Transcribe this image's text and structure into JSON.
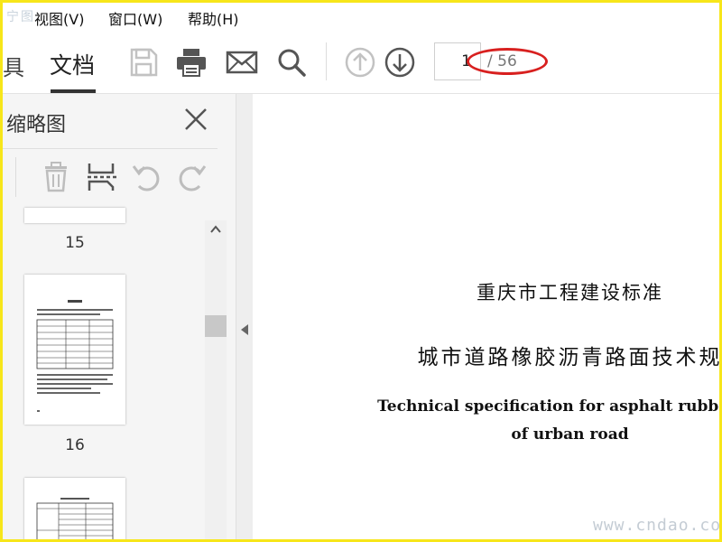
{
  "menu": {
    "watermark": "宁图",
    "items": [
      {
        "label": "视图(V)"
      },
      {
        "label": "窗口(W)"
      },
      {
        "label": "帮助(H)"
      }
    ]
  },
  "toolbar": {
    "partial_tab": "具",
    "doc_tab": "文档",
    "icons": [
      "save-icon",
      "print-icon",
      "mail-icon",
      "search-icon",
      "arrow-up-circle-icon",
      "arrow-down-circle-icon"
    ],
    "page_value": "1",
    "page_total": "/ 56",
    "annotation_color": "#d8201f"
  },
  "sidebar": {
    "title": "缩略图",
    "icons": [
      "trash-icon",
      "extract-pages-icon",
      "rotate-left-icon",
      "rotate-right-icon"
    ],
    "thumbnails": [
      {
        "label": "15"
      },
      {
        "label": "16"
      }
    ]
  },
  "document": {
    "std": "重庆市工程建设标准",
    "title": "城市道路橡胶沥青路面技术规",
    "en_line1": "Technical specification for asphalt rubber pa",
    "en_line2": "of urban road"
  },
  "watermark_bottom": "www.cndao.com",
  "colors": {
    "frame": "#f7e61a",
    "accent": "#d8201f"
  }
}
